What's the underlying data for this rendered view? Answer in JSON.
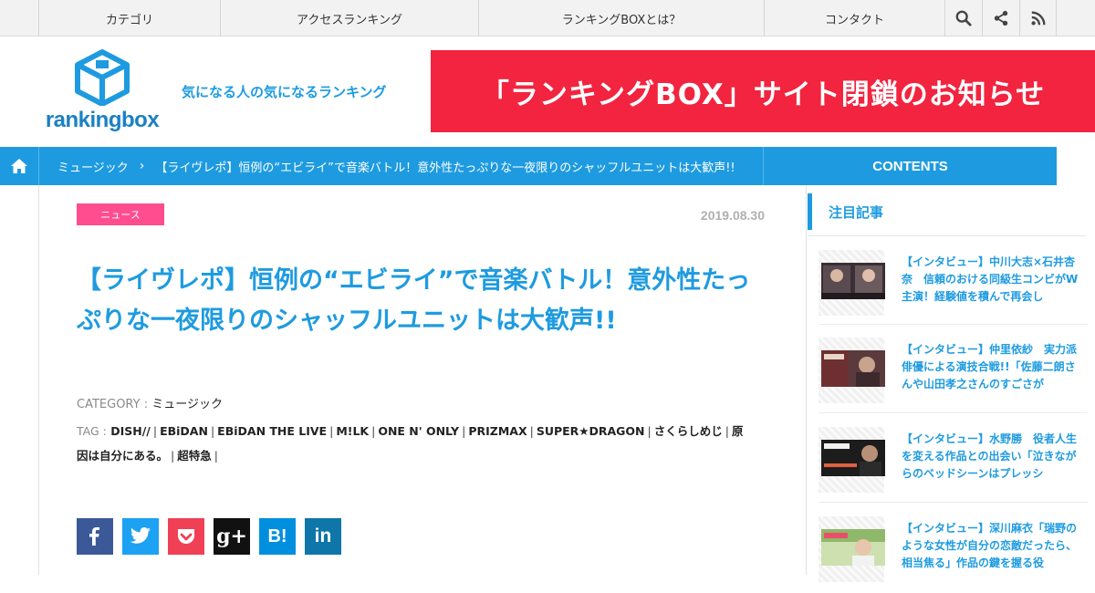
{
  "topnav": {
    "items": [
      "カテゴリ",
      "アクセスランキング",
      "ランキングBOXとは？",
      "コンタクト"
    ],
    "icons": [
      "search-icon",
      "share-icon",
      "rss-icon"
    ]
  },
  "header": {
    "logo_text": "rankingbox",
    "tagline": "気になる人の気になるランキング",
    "banner": "「ランキングBOX」サイト閉鎖のお知らせ"
  },
  "breadcrumb": {
    "category": "ミュージック",
    "current": "【ライヴレポ】恒例の“エビライ”で音楽バトル！意外性たっぷりな一夜限りのシャッフルユニットは大歓声!!",
    "contents_label": "CONTENTS"
  },
  "article": {
    "badge": "ニュース",
    "date": "2019.08.30",
    "title": "【ライヴレポ】恒例の“エビライ”で音楽バトル！意外性たっぷりな一夜限りのシャッフルユニットは大歓声!!",
    "category_label": "CATEGORY :",
    "category": "ミュージック",
    "tag_label": "TAG :",
    "tags": [
      "DISH//",
      "EBiDAN",
      "EBiDAN THE LIVE",
      "M!LK",
      "ONE N' ONLY",
      "PRIZMAX",
      "SUPER★DRAGON",
      "さくらしめじ",
      "原因は自分にある。",
      "超特急"
    ]
  },
  "share": {
    "buttons": [
      {
        "name": "facebook",
        "glyph": "f",
        "color": "#3b5998"
      },
      {
        "name": "twitter",
        "glyph": "",
        "color": "#1da1f2"
      },
      {
        "name": "pocket",
        "glyph": "",
        "color": "#ef4056"
      },
      {
        "name": "google-plus",
        "glyph": "g+",
        "color": "#111111"
      },
      {
        "name": "hatena",
        "glyph": "B!",
        "color": "#008fde"
      },
      {
        "name": "linkedin",
        "glyph": "in",
        "color": "#0e76a8"
      }
    ]
  },
  "sidebar": {
    "heading": "注目記事",
    "items": [
      {
        "text": "【インタビュー】中川大志×石井杏奈　信頼のおける同級生コンビがW主演！経験値を積んで再会し"
      },
      {
        "text": "【インタビュー】仲里依紗　実力派俳優による演技合戦!!「佐藤二朗さんや山田孝之さんのすごさが"
      },
      {
        "text": "【インタビュー】水野勝　役者人生を変える作品との出会い「泣きながらのベッドシーンはプレッシ"
      },
      {
        "text": "【インタビュー】深川麻衣「瑞野のような女性が自分の恋敵だったら、相当焦る」作品の鍵を握る役"
      }
    ]
  }
}
